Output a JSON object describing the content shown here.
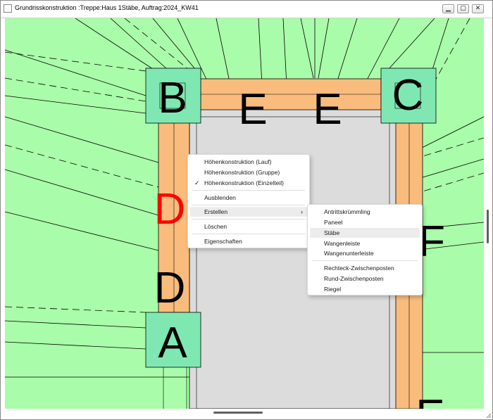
{
  "window": {
    "title": "Grundrisskonstruktion :Treppe:Haus 1Stäbe, Auftrag:2024_KW41",
    "buttons": {
      "minimize": "▁",
      "maximize": "▢",
      "close": "✕"
    }
  },
  "drawing": {
    "post_labels": {
      "b": "B",
      "c": "C",
      "a": "A",
      "d_red": "D",
      "d": "D",
      "e1": "E",
      "e2": "E",
      "f": "F",
      "e_bottom": "E"
    },
    "colors": {
      "background": "#a9fca9",
      "posts": "#7fe8b2",
      "stringer": "#f9bc7c",
      "well": "#dcdcdc",
      "highlight_label": "#ff0000"
    }
  },
  "context_menu": {
    "items": [
      {
        "label": "Höhenkonstruktion (Lauf)"
      },
      {
        "label": "Höhenkonstruktion (Gruppe)"
      },
      {
        "label": "Höhenkonstruktion (Einzelteil)",
        "checked": true
      },
      {
        "label": "Ausblenden"
      },
      {
        "label": "Erstellen",
        "submenu": true,
        "highlighted": true
      },
      {
        "label": "Löschen"
      },
      {
        "label": "Eigenschaften"
      }
    ],
    "check_glyph": "✓",
    "arrow_glyph": "›"
  },
  "submenu": {
    "items": [
      {
        "label": "Antrittskrümmling"
      },
      {
        "label": "Paneel"
      },
      {
        "label": "Stäbe",
        "highlighted": true
      },
      {
        "label": "Wangenleiste"
      },
      {
        "label": "Wangenunterleiste"
      },
      {
        "label": "Rechteck-Zwischenposten"
      },
      {
        "label": "Rund-Zwischenposten"
      },
      {
        "label": "Riegel"
      }
    ]
  }
}
